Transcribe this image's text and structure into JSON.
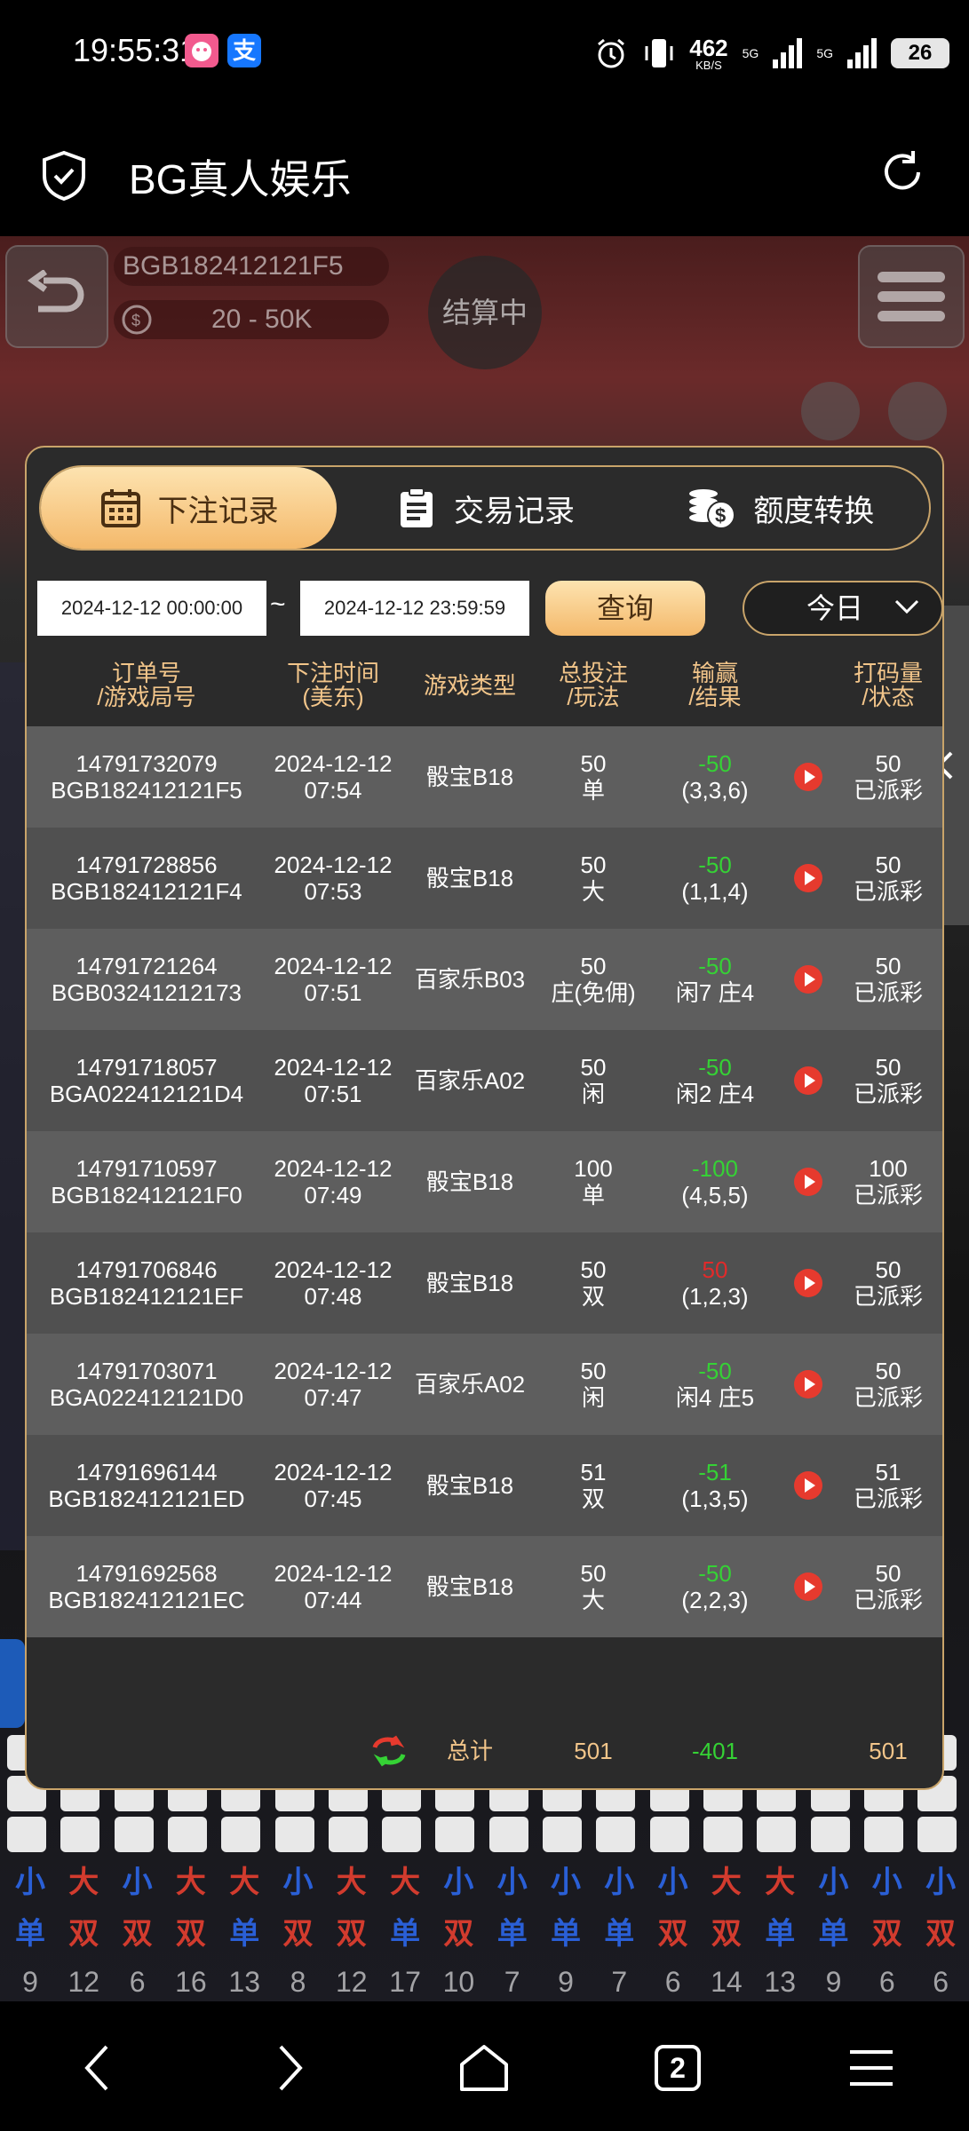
{
  "status_bar": {
    "time": "19:55:31",
    "pay_badge": "支",
    "net_speed": "462",
    "net_unit": "KB/S",
    "net_type_1": "5G",
    "net_type_2": "5G",
    "battery": "26"
  },
  "header": {
    "title": "BG真人娱乐"
  },
  "game": {
    "table_id": "BGB182412121F5",
    "limit": "20 - 50K",
    "status": "结算中",
    "bead_road": [
      {
        "big_small": "小",
        "odd_even": "单",
        "sum": "9"
      },
      {
        "big_small": "大",
        "odd_even": "双",
        "sum": "12"
      },
      {
        "big_small": "小",
        "odd_even": "双",
        "sum": "6"
      },
      {
        "big_small": "大",
        "odd_even": "双",
        "sum": "16"
      },
      {
        "big_small": "大",
        "odd_even": "单",
        "sum": "13"
      },
      {
        "big_small": "小",
        "odd_even": "双",
        "sum": "8"
      },
      {
        "big_small": "大",
        "odd_even": "双",
        "sum": "12"
      },
      {
        "big_small": "大",
        "odd_even": "单",
        "sum": "17"
      },
      {
        "big_small": "小",
        "odd_even": "双",
        "sum": "10"
      },
      {
        "big_small": "小",
        "odd_even": "单",
        "sum": "7"
      },
      {
        "big_small": "小",
        "odd_even": "单",
        "sum": "9"
      },
      {
        "big_small": "小",
        "odd_even": "单",
        "sum": "7"
      },
      {
        "big_small": "小",
        "odd_even": "双",
        "sum": "6"
      },
      {
        "big_small": "大",
        "odd_even": "双",
        "sum": "14"
      },
      {
        "big_small": "大",
        "odd_even": "单",
        "sum": "13"
      },
      {
        "big_small": "小",
        "odd_even": "单",
        "sum": "9"
      },
      {
        "big_small": "小",
        "odd_even": "双",
        "sum": "6"
      },
      {
        "big_small": "小",
        "odd_even": "双",
        "sum": "6"
      }
    ]
  },
  "modal": {
    "tabs": [
      {
        "label": "下注记录",
        "active": true
      },
      {
        "label": "交易记录",
        "active": false
      },
      {
        "label": "额度转换",
        "active": false
      }
    ],
    "filter": {
      "start": "2024-12-12 00:00:00",
      "separator": "~",
      "end": "2024-12-12 23:59:59",
      "query": "查询",
      "period": "今日"
    },
    "columns": {
      "order_1": "订单号",
      "order_2": "/游戏局号",
      "time_1": "下注时间",
      "time_2": "(美东)",
      "game": "游戏类型",
      "bet_1": "总投注",
      "bet_2": "/玩法",
      "win_1": "输赢",
      "win_2": "/结果",
      "code_1": "打码量",
      "code_2": "/状态"
    },
    "rows": [
      {
        "order": "14791732079",
        "round": "BGB182412121F5",
        "date": "2024-12-12",
        "time": "07:54",
        "game": "骰宝B18",
        "bet": "50",
        "play": "单",
        "win": "-50",
        "result": "(3,3,6)",
        "code": "50",
        "status": "已派彩"
      },
      {
        "order": "14791728856",
        "round": "BGB182412121F4",
        "date": "2024-12-12",
        "time": "07:53",
        "game": "骰宝B18",
        "bet": "50",
        "play": "大",
        "win": "-50",
        "result": "(1,1,4)",
        "code": "50",
        "status": "已派彩"
      },
      {
        "order": "14791721264",
        "round": "BGB03241212173",
        "date": "2024-12-12",
        "time": "07:51",
        "game": "百家乐B03",
        "bet": "50",
        "play": "庄(免佣)",
        "win": "-50",
        "result": "闲7 庄4",
        "code": "50",
        "status": "已派彩"
      },
      {
        "order": "14791718057",
        "round": "BGA022412121D4",
        "date": "2024-12-12",
        "time": "07:51",
        "game": "百家乐A02",
        "bet": "50",
        "play": "闲",
        "win": "-50",
        "result": "闲2 庄4",
        "code": "50",
        "status": "已派彩"
      },
      {
        "order": "14791710597",
        "round": "BGB182412121F0",
        "date": "2024-12-12",
        "time": "07:49",
        "game": "骰宝B18",
        "bet": "100",
        "play": "单",
        "win": "-100",
        "result": "(4,5,5)",
        "code": "100",
        "status": "已派彩"
      },
      {
        "order": "14791706846",
        "round": "BGB182412121EF",
        "date": "2024-12-12",
        "time": "07:48",
        "game": "骰宝B18",
        "bet": "50",
        "play": "双",
        "win": "50",
        "result": "(1,2,3)",
        "code": "50",
        "status": "已派彩"
      },
      {
        "order": "14791703071",
        "round": "BGA022412121D0",
        "date": "2024-12-12",
        "time": "07:47",
        "game": "百家乐A02",
        "bet": "50",
        "play": "闲",
        "win": "-50",
        "result": "闲4 庄5",
        "code": "50",
        "status": "已派彩"
      },
      {
        "order": "14791696144",
        "round": "BGB182412121ED",
        "date": "2024-12-12",
        "time": "07:45",
        "game": "骰宝B18",
        "bet": "51",
        "play": "双",
        "win": "-51",
        "result": "(1,3,5)",
        "code": "51",
        "status": "已派彩"
      },
      {
        "order": "14791692568",
        "round": "BGB182412121EC",
        "date": "2024-12-12",
        "time": "07:44",
        "game": "骰宝B18",
        "bet": "50",
        "play": "大",
        "win": "-50",
        "result": "(2,2,3)",
        "code": "50",
        "status": "已派彩"
      }
    ],
    "total": {
      "label": "总计",
      "bet": "501",
      "win": "-401",
      "code": "501"
    }
  },
  "bottom_nav": {
    "tab_count": "2"
  },
  "colors": {
    "gold": "#c9a46a",
    "header_text": "#f2c58a",
    "loss": "#35d235",
    "win": "#e22a2a"
  }
}
